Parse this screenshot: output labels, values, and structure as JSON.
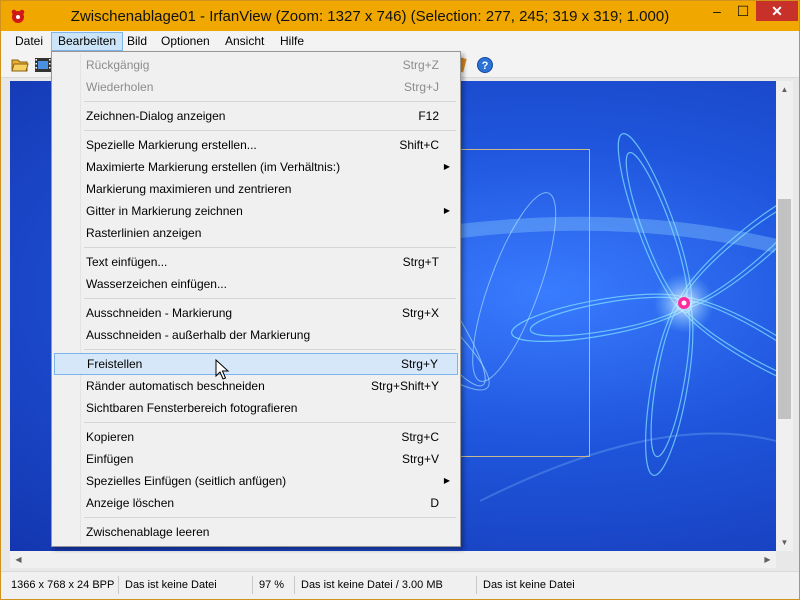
{
  "window": {
    "title": "Zwischenablage01 - IrfanView (Zoom: 1327 x 746) (Selection: 277, 245; 319 x 319; 1.000)",
    "minimize": "–",
    "maximize": "☐",
    "close": "✕"
  },
  "menubar": [
    "Datei",
    "Bearbeiten",
    "Bild",
    "Optionen",
    "Ansicht",
    "Hilfe"
  ],
  "edit_menu": {
    "items": [
      {
        "label": "Rückgängig",
        "shortcut": "Strg+Z",
        "disabled": true
      },
      {
        "label": "Wiederholen",
        "shortcut": "Strg+J",
        "disabled": true
      },
      {
        "label": "Zeichnen-Dialog anzeigen",
        "shortcut": "F12"
      },
      {
        "label": "Spezielle Markierung erstellen...",
        "shortcut": "Shift+C"
      },
      {
        "label": "Maximierte Markierung erstellen (im Verhältnis:)",
        "shortcut": "",
        "submenu": true
      },
      {
        "label": "Markierung maximieren und zentrieren",
        "shortcut": ""
      },
      {
        "label": "Gitter in Markierung zeichnen",
        "shortcut": "",
        "submenu": true
      },
      {
        "label": "Rasterlinien anzeigen",
        "shortcut": ""
      },
      {
        "label": "Text einfügen...",
        "shortcut": "Strg+T"
      },
      {
        "label": "Wasserzeichen einfügen...",
        "shortcut": ""
      },
      {
        "label": "Ausschneiden - Markierung",
        "shortcut": "Strg+X"
      },
      {
        "label": "Ausschneiden - außerhalb der Markierung",
        "shortcut": ""
      },
      {
        "label": "Freistellen",
        "shortcut": "Strg+Y",
        "highlighted": true
      },
      {
        "label": "Ränder automatisch beschneiden",
        "shortcut": "Strg+Shift+Y"
      },
      {
        "label": "Sichtbaren Fensterbereich fotografieren",
        "shortcut": ""
      },
      {
        "label": "Kopieren",
        "shortcut": "Strg+C"
      },
      {
        "label": "Einfügen",
        "shortcut": "Strg+V"
      },
      {
        "label": "Spezielles Einfügen (seitlich anfügen)",
        "shortcut": "",
        "submenu": true
      },
      {
        "label": "Anzeige löschen",
        "shortcut": "D"
      },
      {
        "label": "Zwischenablage leeren",
        "shortcut": ""
      }
    ]
  },
  "statusbar": [
    "1366 x 768 x 24 BPP",
    "Das ist keine Datei",
    "97 %",
    "Das ist keine Datei / 3.00 MB",
    "Das ist keine Datei"
  ],
  "icons": {
    "app": "irfanview-logo-icon",
    "open": "folder-open-icon",
    "slideshow": "filmstrip-icon",
    "paint": "paint-icon",
    "help": "help-icon"
  },
  "colors": {
    "titlebar": "#f0a800",
    "close": "#c7312a",
    "highlight": "#d5e7f8",
    "highlight_border": "#7eb4ea",
    "image_bg": "#1f56dd"
  }
}
